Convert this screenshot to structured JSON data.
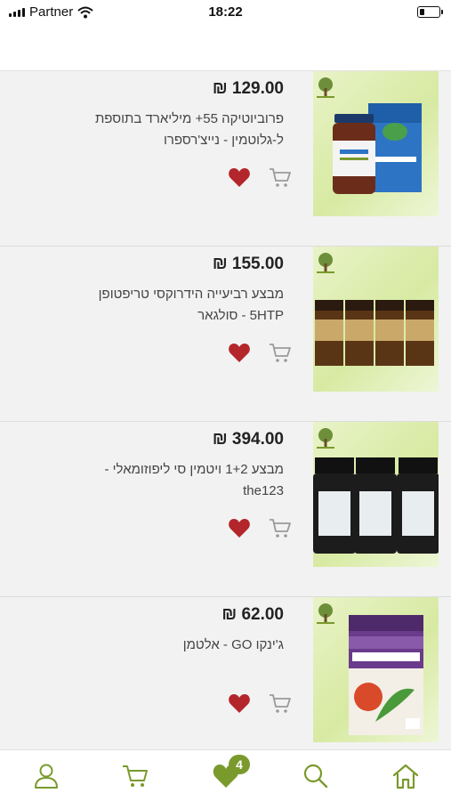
{
  "status_bar": {
    "carrier": "Partner",
    "time": "18:22",
    "battery_level": 0.2
  },
  "products": [
    {
      "price": "₪ 129.00",
      "name": "פרוביוטיקה 55+ מיליארד בתוספת ל-גלוטמין - נייצ'רספרו",
      "image": "probiotic-supplement-bottle-and-box",
      "wishlisted": true
    },
    {
      "price": "₪ 155.00",
      "name": "מבצע רביעייה הידרוקסי טריפטופן 5HTP - סולגאר",
      "image": "four-amber-5htp-jars",
      "wishlisted": true
    },
    {
      "price": "₪ 394.00",
      "name": "מבצע 1+2 ויטמין סי ליפוזומאלי - the123",
      "image": "three-black-vitamin-c-bottles",
      "wishlisted": true
    },
    {
      "price": "₪ 62.00",
      "name": "ג'ינקו GO - אלטמן",
      "image": "ginkgo-go-box",
      "wishlisted": true
    }
  ],
  "tab_bar": {
    "items": [
      "profile",
      "cart",
      "wishlist",
      "search",
      "home"
    ],
    "wishlist_badge": "4"
  },
  "colors": {
    "accent": "#7a9a2c",
    "heart": "#b3262b",
    "icon_gray": "#9a9a9a"
  }
}
